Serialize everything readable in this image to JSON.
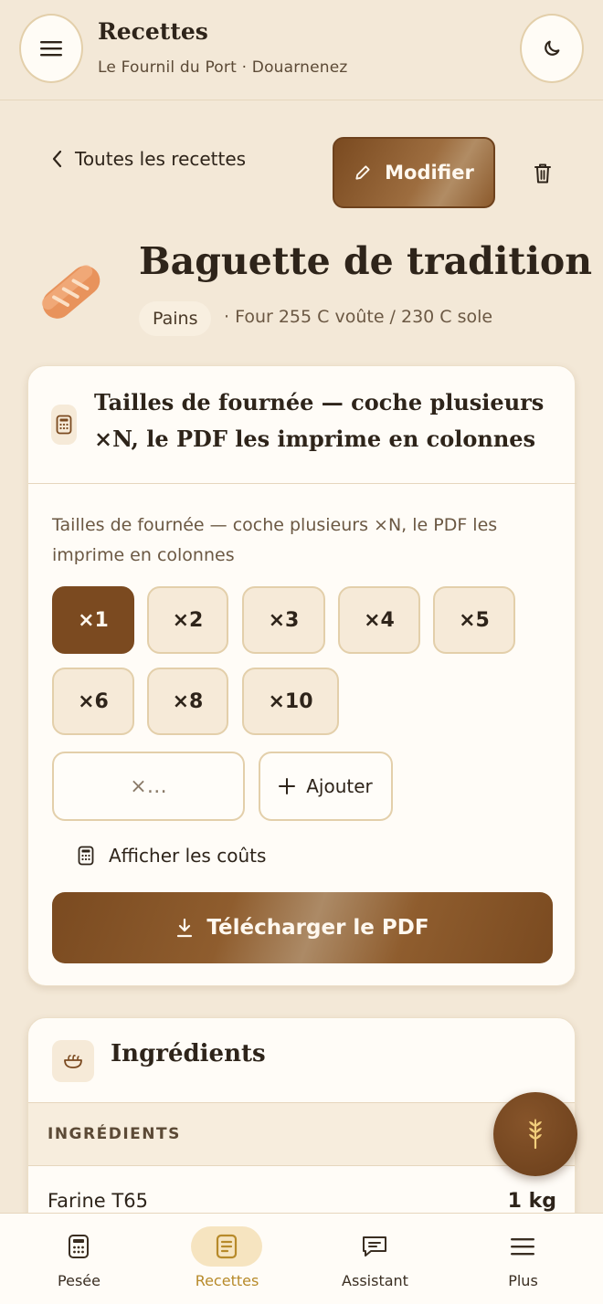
{
  "header": {
    "title": "Recettes",
    "subtitle": "Le Fournil du Port · Douarnenez"
  },
  "toolbar": {
    "back_label": "Toutes les recettes",
    "edit_label": "Modifier"
  },
  "recipe": {
    "title": "Baguette de tradition",
    "category": "Pains",
    "oven": "· Four 255 C voûte / 230 C sole"
  },
  "batch": {
    "title": "Tailles de fournée — coche plusieurs ×N, le PDF les imprime en colonnes",
    "description": "Tailles de fournée — coche plusieurs ×N, le PDF les imprime en colonnes",
    "multipliers": [
      {
        "label": "×1",
        "selected": true
      },
      {
        "label": "×2",
        "selected": false
      },
      {
        "label": "×3",
        "selected": false
      },
      {
        "label": "×4",
        "selected": false
      },
      {
        "label": "×5",
        "selected": false
      },
      {
        "label": "×6",
        "selected": false
      },
      {
        "label": "×8",
        "selected": false
      },
      {
        "label": "×10",
        "selected": false
      }
    ],
    "custom_placeholder": "×…",
    "add_label": "Ajouter",
    "costs_label": "Afficher les coûts",
    "pdf_label": "Télécharger le PDF"
  },
  "ingredients": {
    "title": "Ingrédients",
    "table_header": "INGRÉDIENTS",
    "rows": [
      {
        "name": "Farine T65",
        "qty": "1 kg"
      }
    ]
  },
  "nav": {
    "items": [
      {
        "label": "Pesée",
        "active": false,
        "icon": "calculator-icon"
      },
      {
        "label": "Recettes",
        "active": true,
        "icon": "document-icon"
      },
      {
        "label": "Assistant",
        "active": false,
        "icon": "chat-icon"
      },
      {
        "label": "Plus",
        "active": false,
        "icon": "menu-icon"
      }
    ]
  },
  "colors": {
    "accent": "#7b4a20",
    "background": "#f3e8d7",
    "active_nav": "#b78a2a"
  }
}
